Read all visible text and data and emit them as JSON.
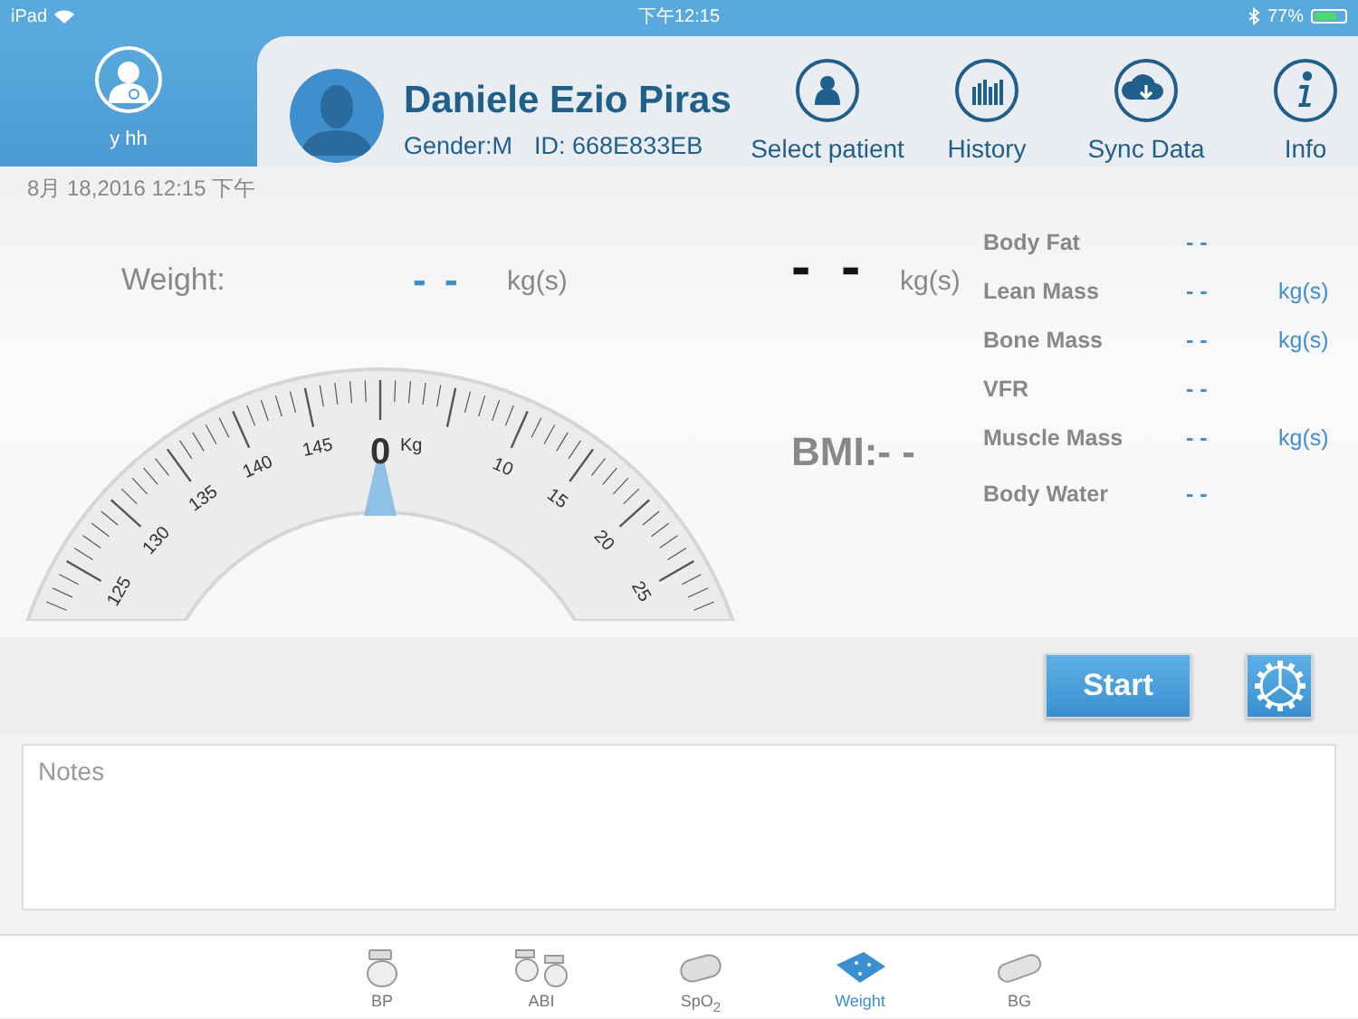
{
  "status_bar": {
    "carrier": "iPad",
    "time": "下午12:15",
    "battery": "77%"
  },
  "user": {
    "name": "y hh"
  },
  "patient": {
    "name": "Daniele Ezio Piras",
    "gender": "Gender:M",
    "id": "ID: 668E833EB"
  },
  "nav": [
    {
      "label": "Select patient",
      "kind": "person"
    },
    {
      "label": "History",
      "kind": "bars"
    },
    {
      "label": "Sync Data",
      "kind": "cloud"
    },
    {
      "label": "Info",
      "kind": "info"
    }
  ],
  "date": "8月 18,2016 12:15 下午",
  "weight": {
    "label": "Weight:",
    "value": "- -",
    "unit": "kg(s)"
  },
  "reading": {
    "value": "- -",
    "unit": "kg(s)"
  },
  "bmi": "BMI:- -",
  "dial": {
    "labels": [
      "125",
      "130",
      "135",
      "140",
      "145",
      "0",
      "10",
      "15",
      "20",
      "25"
    ],
    "unit": "Kg"
  },
  "metrics": [
    {
      "label": "Body Fat",
      "value": "- -"
    },
    {
      "label": "Lean Mass",
      "value": "- -",
      "unit": "kg(s)"
    },
    {
      "label": "Bone Mass",
      "value": "- -",
      "unit": "kg(s)"
    },
    {
      "label": "VFR",
      "value": "- -"
    },
    {
      "label": "Muscle Mass",
      "value": "- -",
      "unit": "kg(s)"
    },
    {
      "label": "Body Water",
      "value": "- -"
    }
  ],
  "start_button": "Start",
  "notes": {
    "placeholder": "Notes"
  },
  "tabs": [
    {
      "label": "BP",
      "kind": "cuff",
      "selected": false
    },
    {
      "label": "ABI",
      "kind": "cuffs",
      "selected": false
    },
    {
      "label": "SpO$_{2}$",
      "kind": "clip",
      "selected": false
    },
    {
      "label": "Weight",
      "kind": "scale",
      "selected": true
    },
    {
      "label": "BG",
      "kind": "meter",
      "selected": false
    }
  ]
}
